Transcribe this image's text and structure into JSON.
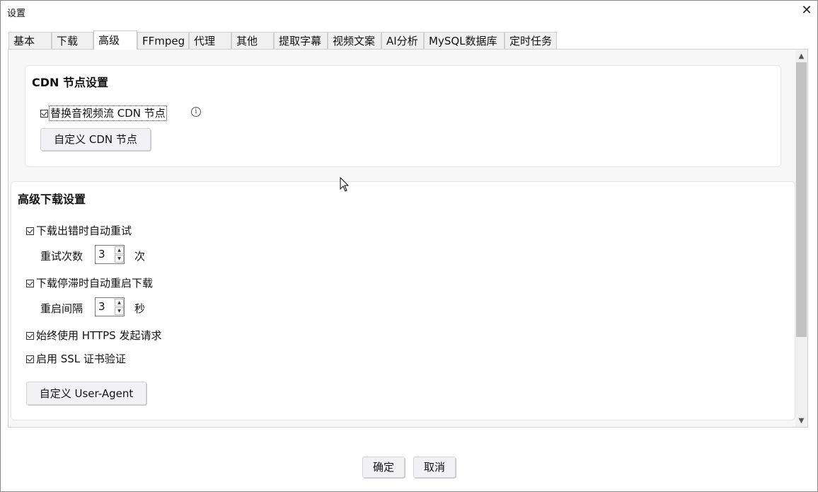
{
  "window": {
    "title": "设置",
    "close": "✕"
  },
  "tabs": [
    {
      "label": "基本"
    },
    {
      "label": "下载"
    },
    {
      "label": "高级"
    },
    {
      "label": "FFmpeg"
    },
    {
      "label": "代理"
    },
    {
      "label": "其他"
    },
    {
      "label": "提取字幕"
    },
    {
      "label": "视频文案"
    },
    {
      "label": "AI分析"
    },
    {
      "label": "MySQL数据库"
    },
    {
      "label": "定时任务"
    }
  ],
  "active_tab": "高级",
  "cdn": {
    "title": "CDN 节点设置",
    "replace_cdn_label": "替换音视频流 CDN 节点",
    "replace_cdn_checked": true,
    "info_icon": "ⓘ",
    "custom_cdn_button": "自定义 CDN 节点"
  },
  "advanced": {
    "title": "高级下载设置",
    "auto_retry_label": "下载出错时自动重试",
    "auto_retry_checked": true,
    "retry_count_label": "重试次数",
    "retry_count_value": "3",
    "retry_count_unit": "次",
    "auto_restart_label": "下载停滞时自动重启下载",
    "auto_restart_checked": true,
    "restart_interval_label": "重启间隔",
    "restart_interval_value": "3",
    "restart_interval_unit": "秒",
    "https_label": "始终使用 HTTPS 发起请求",
    "https_checked": true,
    "ssl_label": "启用 SSL 证书验证",
    "ssl_checked": true,
    "user_agent_button": "自定义 User-Agent"
  },
  "footer": {
    "ok": "确定",
    "cancel": "取消"
  },
  "icons": {
    "spin_up": "▲",
    "spin_down": "▼",
    "scroll_up": "▲",
    "scroll_down": "▼"
  }
}
